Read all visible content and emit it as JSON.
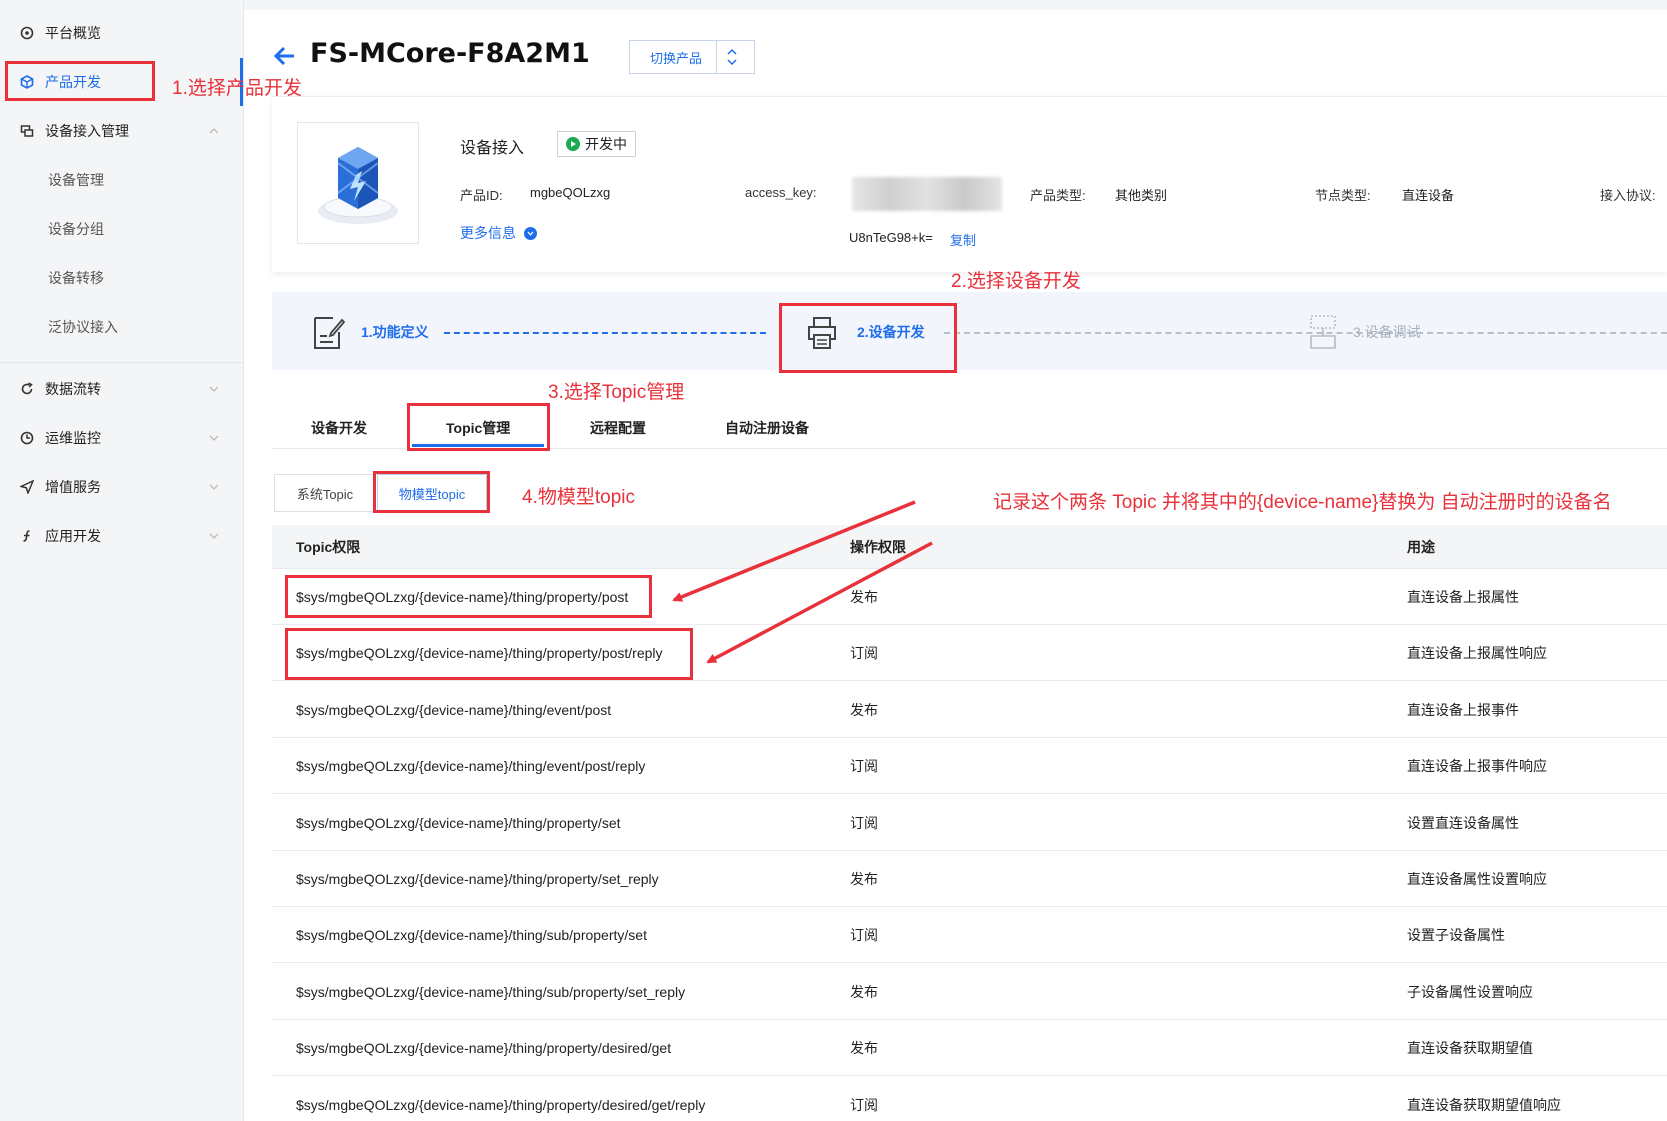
{
  "sidebar": {
    "items": [
      {
        "label": "平台概览",
        "icon": "gauge-icon"
      },
      {
        "label": "产品开发",
        "icon": "cube-icon",
        "active": true
      },
      {
        "label": "设备接入管理",
        "icon": "device-icon"
      },
      {
        "label": "数据流转",
        "icon": "refresh-icon"
      },
      {
        "label": "运维监控",
        "icon": "clock-icon"
      },
      {
        "label": "增值服务",
        "icon": "send-icon"
      },
      {
        "label": "应用开发",
        "icon": "function-icon"
      }
    ],
    "sub_items": [
      "设备管理",
      "设备分组",
      "设备转移",
      "泛协议接入"
    ]
  },
  "header": {
    "title": "FS-MCore-F8A2M1",
    "switch_label": "切换产品"
  },
  "product": {
    "name": "设备接入",
    "status": "开发中",
    "id_label": "产品ID:",
    "id_value": "mgbeQOLzxg",
    "access_key_label": "access_key:",
    "access_key_suffix": "U8nTeG98+k=",
    "copy_label": "复制",
    "type_label": "产品类型:",
    "type_value": "其他类别",
    "node_label": "节点类型:",
    "node_value": "直连设备",
    "protocol_label": "接入协议:",
    "more_label": "更多信息"
  },
  "steps": [
    {
      "label": "1.功能定义"
    },
    {
      "label": "2.设备开发"
    },
    {
      "label": "3.设备调试"
    }
  ],
  "tabs": [
    "设备开发",
    "Topic管理",
    "远程配置",
    "自动注册设备"
  ],
  "subtabs": [
    "系统Topic",
    "物模型topic"
  ],
  "table": {
    "columns": [
      "Topic权限",
      "操作权限",
      "用途"
    ],
    "rows": [
      {
        "topic": "$sys/mgbeQOLzxg/{device-name}/thing/property/post",
        "perm": "发布",
        "use": "直连设备上报属性"
      },
      {
        "topic": "$sys/mgbeQOLzxg/{device-name}/thing/property/post/reply",
        "perm": "订阅",
        "use": "直连设备上报属性响应"
      },
      {
        "topic": "$sys/mgbeQOLzxg/{device-name}/thing/event/post",
        "perm": "发布",
        "use": "直连设备上报事件"
      },
      {
        "topic": "$sys/mgbeQOLzxg/{device-name}/thing/event/post/reply",
        "perm": "订阅",
        "use": "直连设备上报事件响应"
      },
      {
        "topic": "$sys/mgbeQOLzxg/{device-name}/thing/property/set",
        "perm": "订阅",
        "use": "设置直连设备属性"
      },
      {
        "topic": "$sys/mgbeQOLzxg/{device-name}/thing/property/set_reply",
        "perm": "发布",
        "use": "直连设备属性设置响应"
      },
      {
        "topic": "$sys/mgbeQOLzxg/{device-name}/thing/sub/property/set",
        "perm": "订阅",
        "use": "设置子设备属性"
      },
      {
        "topic": "$sys/mgbeQOLzxg/{device-name}/thing/sub/property/set_reply",
        "perm": "发布",
        "use": "子设备属性设置响应"
      },
      {
        "topic": "$sys/mgbeQOLzxg/{device-name}/thing/property/desired/get",
        "perm": "发布",
        "use": "直连设备获取期望值"
      },
      {
        "topic": "$sys/mgbeQOLzxg/{device-name}/thing/property/desired/get/reply",
        "perm": "订阅",
        "use": "直连设备获取期望值响应"
      }
    ]
  },
  "annotations": {
    "step1": "1.选择产品开发",
    "step2": "2.选择设备开发",
    "step3": "3.选择Topic管理",
    "step4": "4.物模型topic",
    "note": "记录这个两条 Topic 并将其中的{device-name}替换为 自动注册时的设备名"
  },
  "colors": {
    "accent": "#1f6dea",
    "annotation": "#e8313a",
    "status": "#1aaa55"
  }
}
